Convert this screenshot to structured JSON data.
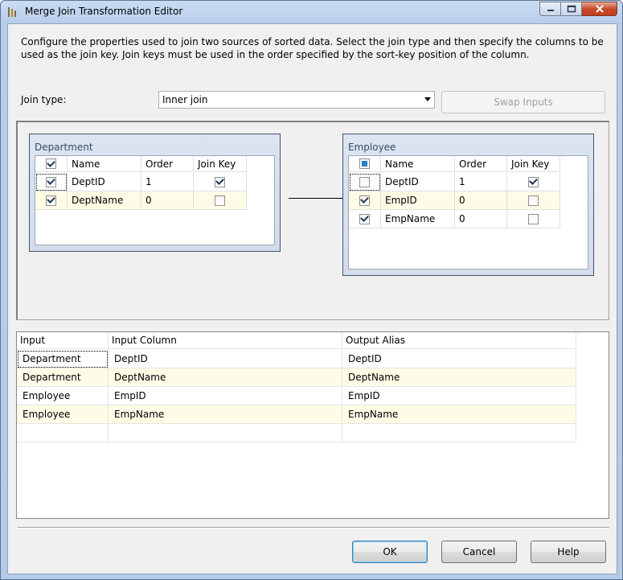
{
  "window": {
    "title": "Merge Join Transformation Editor"
  },
  "description": "Configure the properties used to join two sources of sorted data. Select the join type and then specify the columns to be used as the join key. Join keys must be used in the order specified by the sort-key position of the column.",
  "join_type": {
    "label": "Join type:",
    "value": "Inner join"
  },
  "swap_inputs": {
    "label": "Swap Inputs"
  },
  "left_table": {
    "title": "Department",
    "columns": [
      "Name",
      "Order",
      "Join Key"
    ],
    "rows": [
      {
        "name": "DeptID",
        "order": "1"
      },
      {
        "name": "DeptName",
        "order": "0"
      }
    ]
  },
  "right_table": {
    "title": "Employee",
    "columns": [
      "Name",
      "Order",
      "Join Key"
    ],
    "rows": [
      {
        "name": "DeptID",
        "order": "1"
      },
      {
        "name": "EmpID",
        "order": "0"
      },
      {
        "name": "EmpName",
        "order": "0"
      }
    ]
  },
  "output_grid": {
    "headers": [
      "Input",
      "Input Column",
      "Output Alias"
    ],
    "rows": [
      [
        "Department",
        "DeptID",
        "DeptID"
      ],
      [
        "Department",
        "DeptName",
        "DeptName"
      ],
      [
        "Employee",
        "EmpID",
        "EmpID"
      ],
      [
        "Employee",
        "EmpName",
        "EmpName"
      ]
    ]
  },
  "buttons": {
    "ok": "OK",
    "cancel": "Cancel",
    "help": "Help"
  }
}
